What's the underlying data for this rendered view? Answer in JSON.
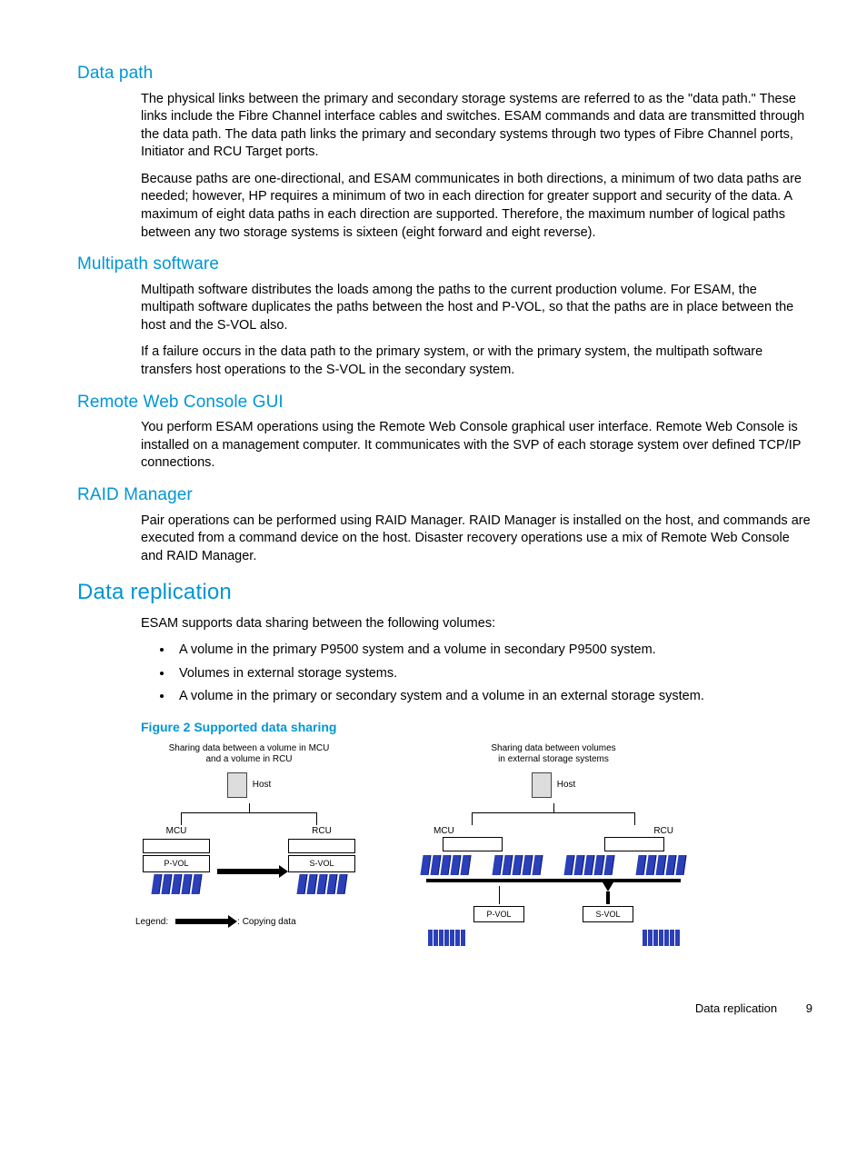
{
  "sections": {
    "data_path": {
      "title": "Data path",
      "p1": "The physical links between the primary and secondary storage systems are referred to as the \"data path.\" These links include the Fibre Channel interface cables and switches. ESAM commands and data are transmitted through the data path. The data path links the primary and secondary systems through two types of Fibre Channel ports, Initiator and RCU Target ports.",
      "p2": "Because paths are one-directional, and ESAM communicates in both directions, a minimum of two data paths are needed; however, HP requires a minimum of two in each direction for greater support and security of the data. A maximum of eight data paths in each direction are supported. Therefore, the maximum number of logical paths between any two storage systems is sixteen (eight forward and eight reverse)."
    },
    "multipath": {
      "title": "Multipath software",
      "p1": "Multipath software distributes the loads among the paths to the current production volume. For ESAM, the multipath software duplicates the paths between the host and P-VOL, so that the paths are in place between the host and the S-VOL also.",
      "p2": "If a failure occurs in the data path to the primary system, or with the primary system, the multipath software transfers host operations to the S-VOL in the secondary system."
    },
    "rwc": {
      "title": "Remote Web Console GUI",
      "p1": "You perform ESAM operations using the Remote Web Console graphical user interface. Remote Web Console is installed on a management computer. It communicates with the SVP of each storage system over defined TCP/IP connections."
    },
    "raid": {
      "title": "RAID Manager",
      "p1": "Pair operations can be performed using RAID Manager. RAID Manager is installed on the host, and commands are executed from a command device on the host. Disaster recovery operations use a mix of Remote Web Console and RAID Manager."
    },
    "replication": {
      "title": "Data replication",
      "intro": "ESAM supports data sharing between the following volumes:",
      "bullets": [
        "A volume in the primary P9500 system and a volume in secondary P9500 system.",
        "Volumes in external storage systems.",
        "A volume in the primary or secondary system and a volume in an external storage system."
      ],
      "figure_caption": "Figure 2 Supported data sharing"
    }
  },
  "diagram": {
    "left_title_l1": "Sharing data between a volume in MCU",
    "left_title_l2": "and a volume in RCU",
    "right_title_l1": "Sharing data between volumes",
    "right_title_l2": "in external storage systems",
    "host": "Host",
    "mcu": "MCU",
    "rcu": "RCU",
    "pvol": "P-VOL",
    "svol": "S-VOL",
    "legend_label": "Legend:",
    "legend_text": ": Copying data"
  },
  "footer": {
    "section": "Data replication",
    "page": "9"
  }
}
